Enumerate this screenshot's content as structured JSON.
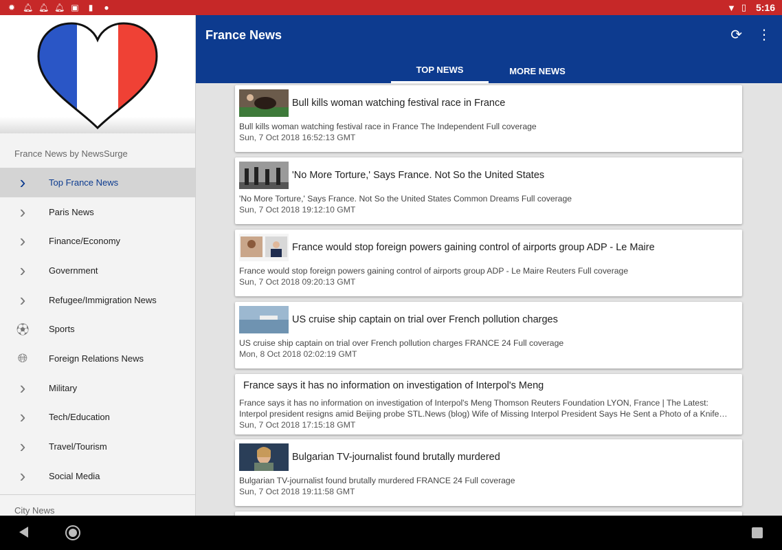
{
  "status": {
    "time": "5:16"
  },
  "drawer": {
    "subheader": "France News by NewsSurge",
    "items": [
      {
        "label": "Top France News",
        "icon": "chevron-right-icon",
        "selected": true
      },
      {
        "label": "Paris News",
        "icon": "chevron-right-icon"
      },
      {
        "label": "Finance/Economy",
        "icon": "chevron-right-icon"
      },
      {
        "label": "Government",
        "icon": "chevron-right-icon"
      },
      {
        "label": "Refugee/Immigration News",
        "icon": "chevron-right-icon"
      },
      {
        "label": "Sports",
        "icon": "soccer-ball-icon"
      },
      {
        "label": "Foreign Relations News",
        "icon": "globe-icon"
      },
      {
        "label": "Military",
        "icon": "chevron-right-icon"
      },
      {
        "label": "Tech/Education",
        "icon": "chevron-right-icon"
      },
      {
        "label": "Travel/Tourism",
        "icon": "chevron-right-icon"
      },
      {
        "label": "Social Media",
        "icon": "chevron-right-icon"
      }
    ],
    "section_label": "City News"
  },
  "appbar": {
    "title": "France News",
    "tabs": [
      {
        "label": "TOP NEWS",
        "active": true
      },
      {
        "label": "MORE NEWS"
      }
    ]
  },
  "articles": [
    {
      "title": "Bull kills woman watching festival race in France",
      "desc": "Bull kills woman watching festival race in France  The Independent  Full coverage",
      "date": "Sun, 7 Oct 2018 16:52:13 GMT",
      "thumb": "bull"
    },
    {
      "title": "'No More Torture,' Says France. Not So the United States",
      "desc": "'No More Torture,' Says France. Not So the United States  Common Dreams  Full coverage",
      "date": "Sun, 7 Oct 2018 19:12:10 GMT",
      "thumb": "soldiers"
    },
    {
      "title": "France would stop foreign powers gaining control of airports group ADP - Le Maire",
      "desc": "France would stop foreign powers gaining control of airports group ADP - Le Maire  Reuters  Full coverage",
      "date": "Sun, 7 Oct 2018 09:20:13 GMT",
      "thumb": "people"
    },
    {
      "title": "US cruise ship captain on trial over French pollution charges",
      "desc": "US cruise ship captain on trial over French pollution charges  FRANCE 24  Full coverage",
      "date": "Mon, 8 Oct 2018 02:02:19 GMT",
      "thumb": "sea"
    },
    {
      "title": "France says it has no information on investigation of Interpol's Meng",
      "desc": "France says it has no information on investigation of Interpol's Meng  Thomson Reuters Foundation  LYON, France | The Latest: Interpol president resigns amid Beijing probe  STL.News (blog)  Wife of Missing Interpol President Says He Sent a Photo of a Knife…",
      "date": "Sun, 7 Oct 2018 17:15:18 GMT",
      "thumb": ""
    },
    {
      "title": "Bulgarian TV-journalist found brutally murdered",
      "desc": "Bulgarian TV-journalist found brutally murdered  FRANCE 24  Full coverage",
      "date": "Sun, 7 Oct 2018 19:11:58 GMT",
      "thumb": "portrait"
    }
  ]
}
